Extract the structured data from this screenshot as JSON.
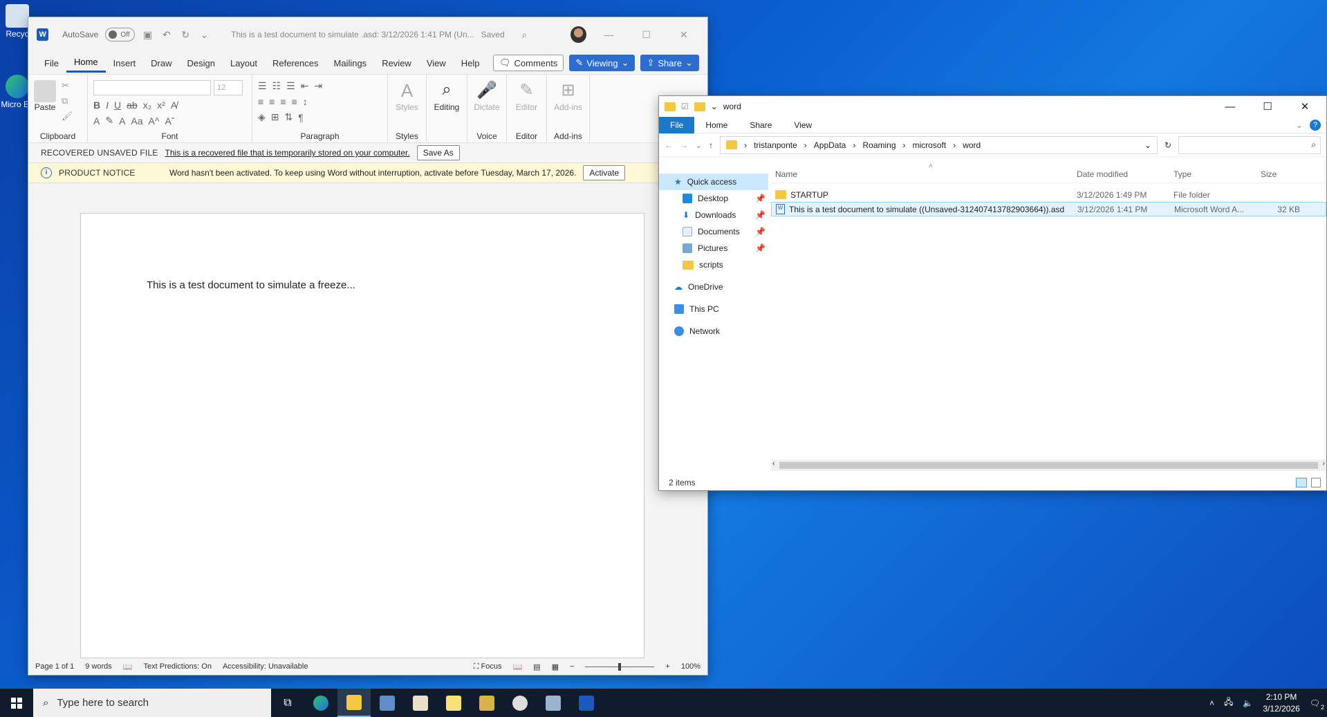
{
  "desktop": {
    "icons": [
      {
        "label": "Recyc"
      },
      {
        "label": "Micro Ed"
      }
    ]
  },
  "word": {
    "autosave_label": "AutoSave",
    "autosave_state": "Off",
    "doc_title": "This is a test document to simulate .asd: 3/12/2026 1:41 PM (Un...",
    "saved_status": "Saved",
    "menu": [
      "File",
      "Home",
      "Insert",
      "Draw",
      "Design",
      "Layout",
      "References",
      "Mailings",
      "Review",
      "View",
      "Help"
    ],
    "active_menu": "Home",
    "comments_label": "Comments",
    "viewing_label": "Viewing",
    "share_label": "Share",
    "ribbon": {
      "paste_label": "Paste",
      "font_size": "12",
      "groups": {
        "clipboard": "Clipboard",
        "font": "Font",
        "paragraph": "Paragraph",
        "styles": "Styles",
        "voice": "Voice",
        "editor": "Editor",
        "addins": "Add-ins"
      },
      "styles_label": "Styles",
      "editing_label": "Editing",
      "dictate_label": "Dictate",
      "editor_label": "Editor",
      "addins_label": "Add-ins"
    },
    "recovered": {
      "label": "RECOVERED UNSAVED FILE",
      "message": "This is a recovered file that is temporarily stored on your computer.",
      "button": "Save As"
    },
    "notice": {
      "label": "PRODUCT NOTICE",
      "message": "Word hasn't been activated. To keep using Word without interruption, activate before Tuesday, March 17, 2026.",
      "button": "Activate"
    },
    "body_text": "This is a test document to simulate a freeze...",
    "status": {
      "page": "Page 1 of 1",
      "words": "9 words",
      "predictions": "Text Predictions: On",
      "accessibility": "Accessibility: Unavailable",
      "focus": "Focus",
      "zoom": "100%"
    }
  },
  "explorer": {
    "title": "word",
    "tabs": [
      "File",
      "Home",
      "Share",
      "View"
    ],
    "path": [
      "tristanponte",
      "AppData",
      "Roaming",
      "microsoft",
      "word"
    ],
    "nav": {
      "quick_access": "Quick access",
      "pinned": [
        "Desktop",
        "Downloads",
        "Documents",
        "Pictures"
      ],
      "scripts": "scripts",
      "onedrive": "OneDrive",
      "thispc": "This PC",
      "network": "Network"
    },
    "columns": {
      "name": "Name",
      "date": "Date modified",
      "type": "Type",
      "size": "Size"
    },
    "files": [
      {
        "name": "STARTUP",
        "date": "3/12/2026 1:49 PM",
        "type": "File folder",
        "size": ""
      },
      {
        "name": "This is a test document to simulate ((Unsaved-312407413782903664)).asd",
        "date": "3/12/2026 1:41 PM",
        "type": "Microsoft Word A...",
        "size": "32 KB"
      }
    ],
    "status": "2 items"
  },
  "taskbar": {
    "search_placeholder": "Type here to search",
    "time": "2:10 PM",
    "date": "3/12/2026",
    "notifications": "2"
  }
}
